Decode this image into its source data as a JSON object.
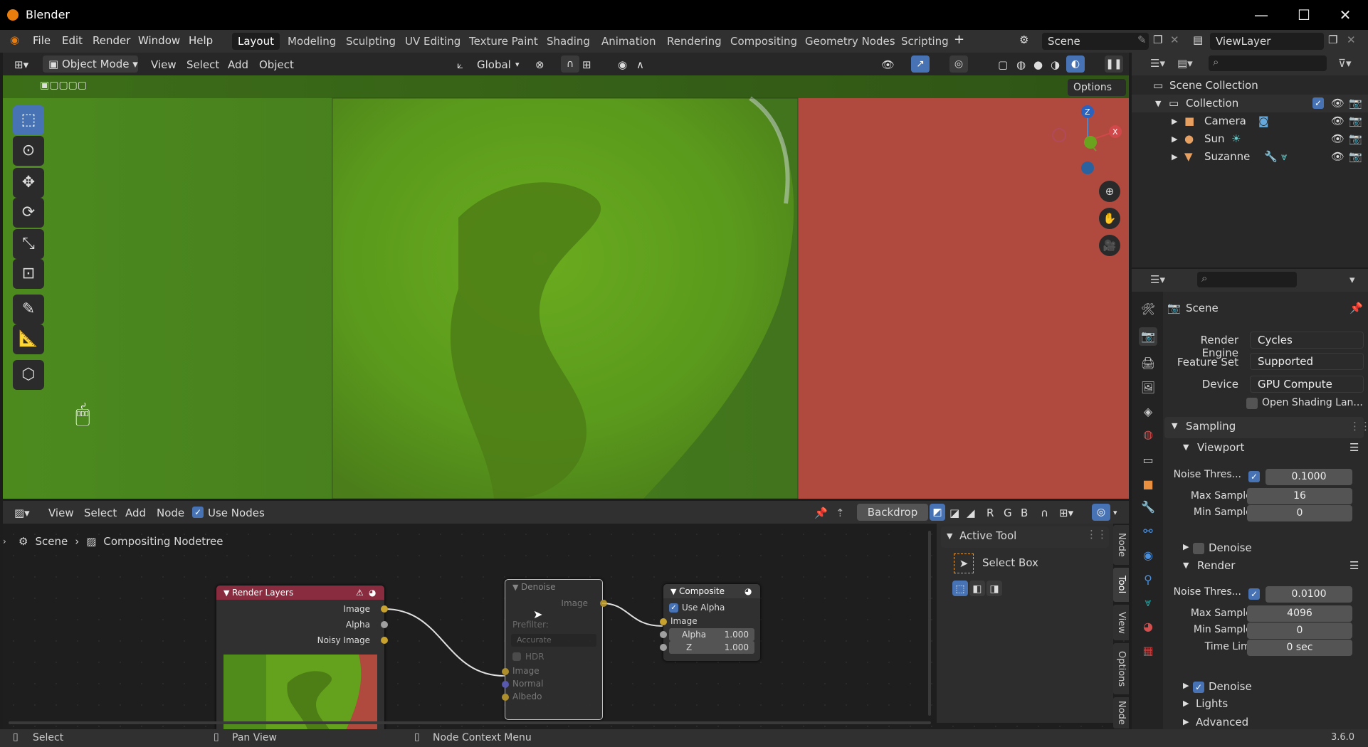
{
  "window": {
    "title": "Blender"
  },
  "menu": [
    "File",
    "Edit",
    "Render",
    "Window",
    "Help"
  ],
  "workspaces": [
    "Layout",
    "Modeling",
    "Sculpting",
    "UV Editing",
    "Texture Paint",
    "Shading",
    "Animation",
    "Rendering",
    "Compositing",
    "Geometry Nodes",
    "Scripting"
  ],
  "scene_name": "Scene",
  "view_layer": "ViewLayer",
  "viewport_header": {
    "mode": "Object Mode",
    "menus": [
      "View",
      "Select",
      "Add",
      "Object"
    ],
    "orientation": "Global",
    "options": "Options"
  },
  "gizmo": {
    "z": "Z",
    "x": "X"
  },
  "outliner": {
    "root": "Scene Collection",
    "collection": "Collection",
    "items": [
      "Camera",
      "Sun",
      "Suzanne"
    ]
  },
  "properties": {
    "title": "Scene",
    "render_engine_label": "Render Engine",
    "render_engine": "Cycles",
    "feature_set_label": "Feature Set",
    "feature_set": "Supported",
    "device_label": "Device",
    "device": "GPU Compute",
    "osl": "Open Shading Lan...",
    "sampling": "Sampling",
    "viewport": "Viewport",
    "vp_noise_label": "Noise Thres...",
    "vp_noise": "0.1000",
    "vp_max_label": "Max Samples",
    "vp_max": "16",
    "vp_min_label": "Min Samples",
    "vp_min": "0",
    "denoise": "Denoise",
    "render": "Render",
    "r_noise_label": "Noise Thres...",
    "r_noise": "0.0100",
    "r_max_label": "Max Samples",
    "r_max": "4096",
    "r_min_label": "Min Samples",
    "r_min": "0",
    "time_label": "Time Limit",
    "time": "0 sec",
    "r_denoise": "Denoise",
    "lights": "Lights",
    "advanced": "Advanced"
  },
  "node_header": {
    "menus": [
      "View",
      "Select",
      "Add",
      "Node"
    ],
    "use_nodes": "Use Nodes",
    "backdrop": "Backdrop",
    "channels": [
      "R",
      "G",
      "B"
    ]
  },
  "breadcrumb": {
    "scene": "Scene",
    "tree": "Compositing Nodetree"
  },
  "nodes": {
    "render_layers": {
      "title": "Render Layers",
      "outputs": [
        "Image",
        "Alpha",
        "Noisy Image"
      ]
    },
    "denoise": {
      "title": "Denoise",
      "output": "Image",
      "prefilter_label": "Prefilter:",
      "prefilter": "Accurate",
      "hdr": "HDR",
      "inputs": [
        "Image",
        "Normal",
        "Albedo"
      ]
    },
    "composite": {
      "title": "Composite",
      "use_alpha": "Use Alpha",
      "image": "Image",
      "alpha_label": "Alpha",
      "alpha": "1.000",
      "z_label": "Z",
      "z": "1.000"
    }
  },
  "sidebar": {
    "title": "Active Tool",
    "tool": "Select Box",
    "tabs": [
      "Node",
      "Tool",
      "View",
      "Options",
      "Node"
    ]
  },
  "status": {
    "select": "Select",
    "pan": "Pan View",
    "context": "Node Context Menu",
    "version": "3.6.0"
  }
}
